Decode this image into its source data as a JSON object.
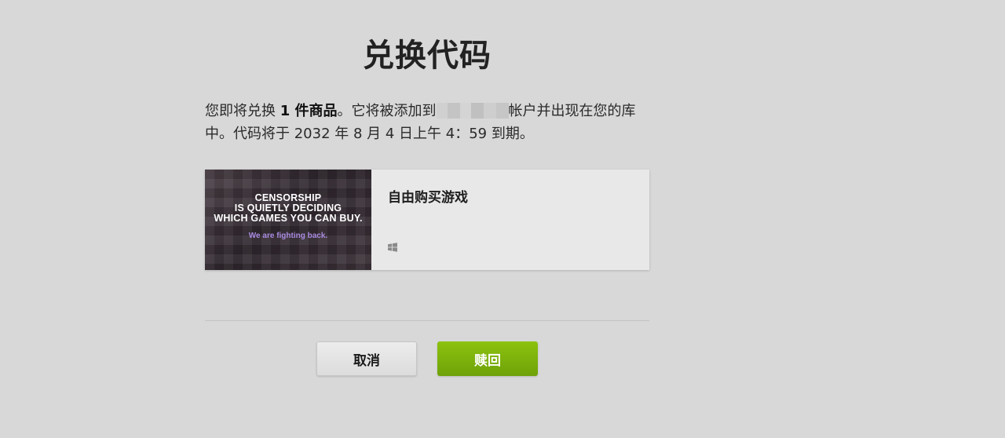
{
  "title": "兑换代码",
  "description": {
    "prefix": "您即将兑换 ",
    "count_bold": "1 件商品",
    "middle": "。它将被添加到",
    "suffix": "帐户并出现在您的库中。代码将于 2032 年 8 月 4 日上午 4：59 到期。"
  },
  "product": {
    "image_text_line1": "CENSORSHIP",
    "image_text_line2": "IS QUIETLY DECIDING",
    "image_text_line3": "WHICH GAMES YOU CAN BUY.",
    "image_tagline": "We are fighting back.",
    "name": "自由购买游戏",
    "platform_icon": "windows-icon"
  },
  "buttons": {
    "cancel_label": "取消",
    "redeem_label": "赎回"
  },
  "colors": {
    "accent_green": "#7fb20b",
    "background": "#d8d8d8",
    "tagline_purple": "#a98be0"
  }
}
